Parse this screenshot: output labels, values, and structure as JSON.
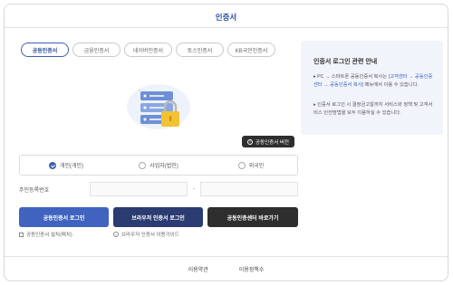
{
  "header": {
    "title": "인증서"
  },
  "tabs": [
    {
      "label": "공동인증서",
      "active": true
    },
    {
      "label": "금융인증서",
      "active": false
    },
    {
      "label": "네이버인증서",
      "active": false
    },
    {
      "label": "토스인증서",
      "active": false
    },
    {
      "label": "KB국민인증서",
      "active": false
    }
  ],
  "version_button": {
    "label": "공동인증서 버전"
  },
  "user_type": {
    "options": [
      "개인(개인)",
      "사업자(법인)",
      "외국인"
    ],
    "selected": "개인(개인)"
  },
  "id_field": {
    "label": "주민등록번호",
    "separator": "-"
  },
  "buttons": {
    "cert_login": "공동인증서 로그인",
    "browser_login": "브라우저 인증서 로그인",
    "center": "공동인증센터 바로가기"
  },
  "links": {
    "install": "공동인증서 설치(패치)",
    "guide": "브라우저 인증서 이용가이드"
  },
  "footer": {
    "privacy": "이용약관",
    "terms": "이용정책수"
  },
  "info_panel": {
    "title": "인증서 로그인 관련 안내",
    "note1_a": "PC → 스마트폰 공동인증서 복사는 ",
    "note1_link": "[고객센터 → 공동인증센터 → 공동인증서 복사]",
    "note1_b": " 메뉴에서 이용 수 있습니다.",
    "note2": "인증서 로그인 시 결정금고알까지 서비스와 정책 및 고객서비스 안전방법을 모두 이용하실 수 있습니다."
  },
  "colors": {
    "primary": "#3f63bf",
    "navy": "#2b3c72",
    "dark": "#2e2e2e",
    "lock": "#f2c233"
  }
}
